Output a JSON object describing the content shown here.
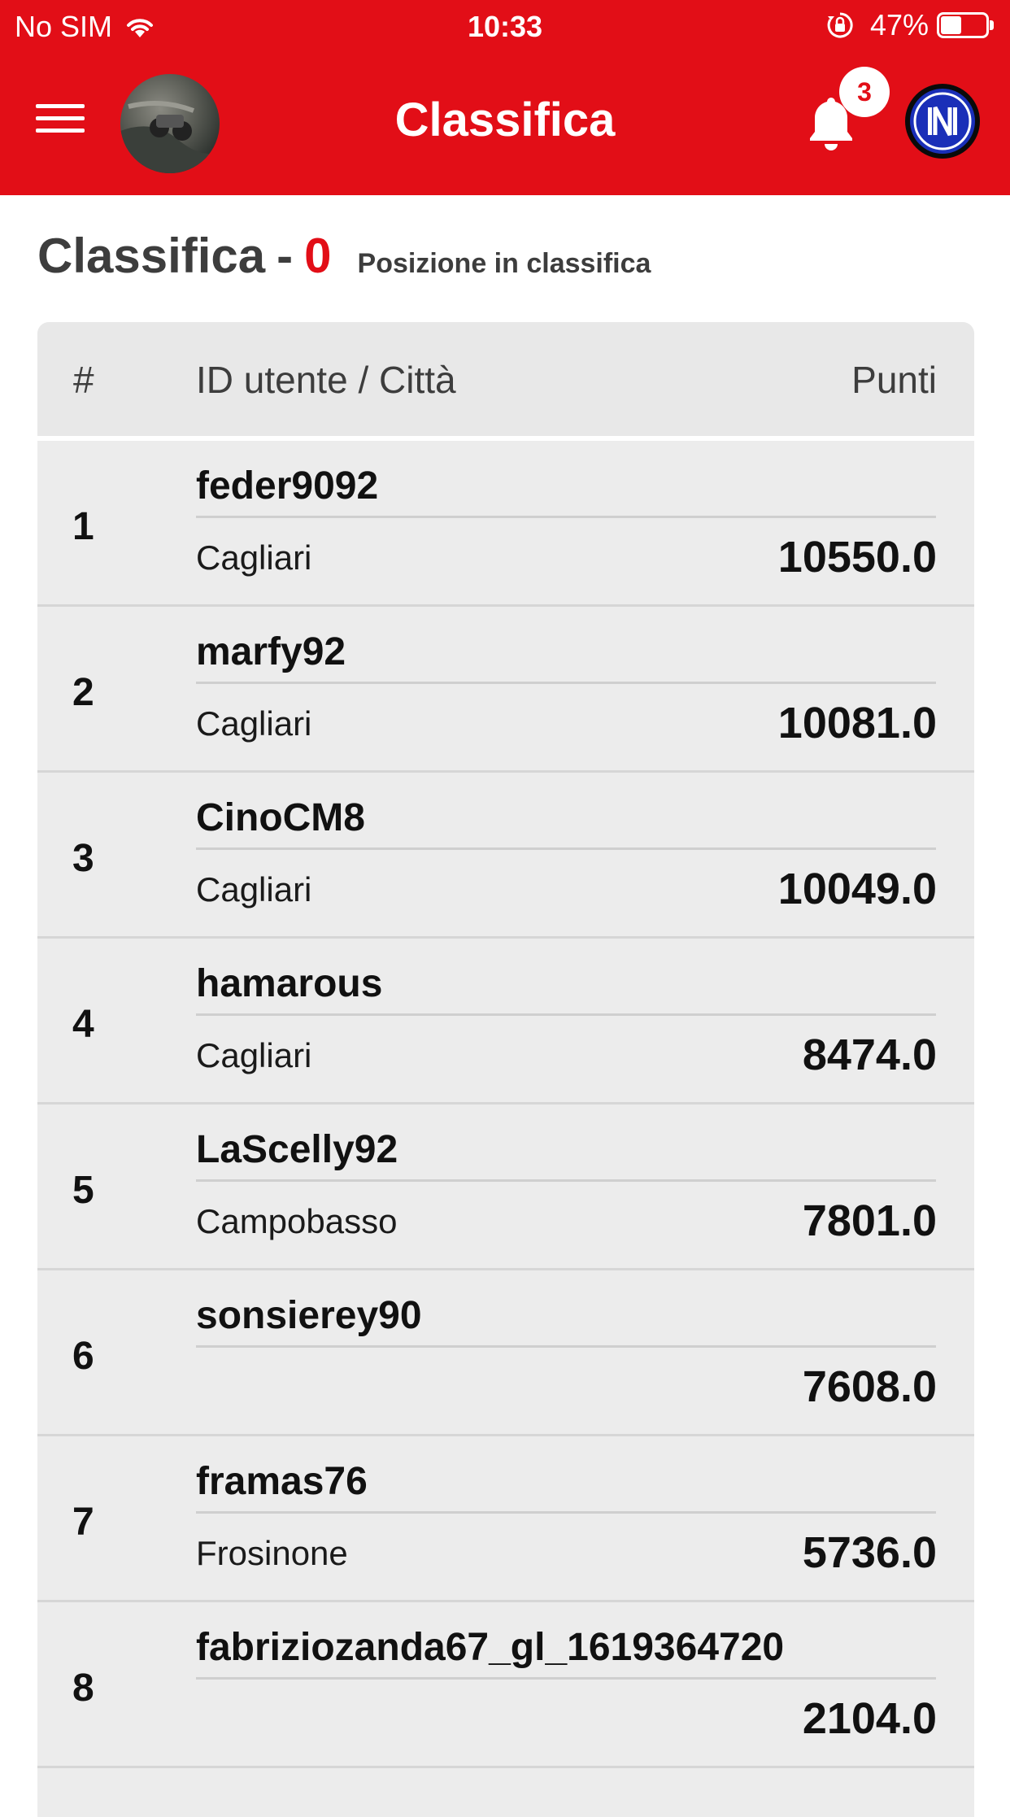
{
  "status_bar": {
    "carrier": "No SIM",
    "time": "10:33",
    "battery_percent_label": "47%",
    "battery_level": 0.47,
    "icons": [
      "wifi-icon",
      "orientation-lock-icon",
      "battery-icon"
    ]
  },
  "nav": {
    "title": "Classifica",
    "notification_count": "3",
    "icons": [
      "menu-icon",
      "bell-icon",
      "club-logo"
    ]
  },
  "heading": {
    "title": "Classifica",
    "separator": "-",
    "position": "0",
    "caption": "Posizione in classifica"
  },
  "table": {
    "headers": {
      "rank": "#",
      "user": "ID utente / Città",
      "points": "Punti"
    },
    "rows": [
      {
        "rank": "1",
        "username": "feder9092",
        "city": "Cagliari",
        "points": "10550.0"
      },
      {
        "rank": "2",
        "username": "marfy92",
        "city": "Cagliari",
        "points": "10081.0"
      },
      {
        "rank": "3",
        "username": "CinoCM8",
        "city": "Cagliari",
        "points": "10049.0"
      },
      {
        "rank": "4",
        "username": "hamarous",
        "city": "Cagliari",
        "points": "8474.0"
      },
      {
        "rank": "5",
        "username": "LaScelly92",
        "city": "Campobasso",
        "points": "7801.0"
      },
      {
        "rank": "6",
        "username": "sonsierey90",
        "city": "",
        "points": "7608.0"
      },
      {
        "rank": "7",
        "username": "framas76",
        "city": "Frosinone",
        "points": "5736.0"
      },
      {
        "rank": "8",
        "username": "fabriziozanda67_gl_1619364720",
        "city": "",
        "points": "2104.0"
      }
    ]
  },
  "colors": {
    "brand_red": "#e20e17",
    "row_background": "#ececec",
    "text_dark": "#111111"
  }
}
